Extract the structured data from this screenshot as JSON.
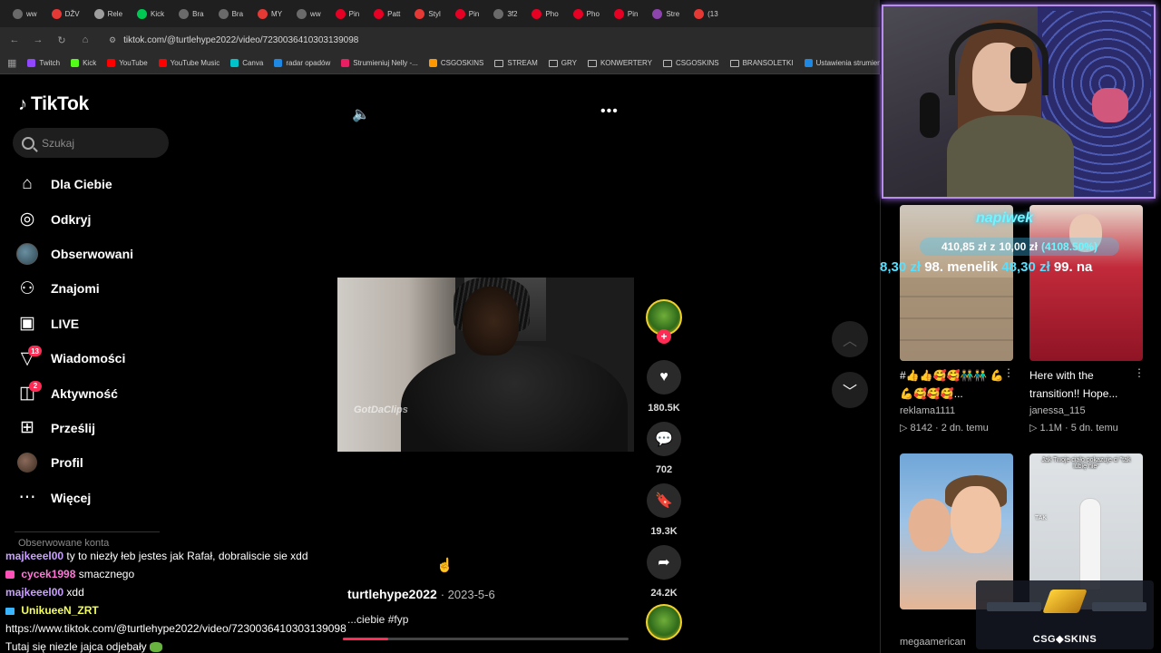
{
  "browser": {
    "tabs": [
      "ww",
      "DŽV",
      "Rele",
      "Kick",
      "Bra",
      "Bra",
      "MY",
      "ww",
      "Pin",
      "Patt",
      "Styl",
      "Pin",
      "3f2",
      "Pho",
      "Pho",
      "Pin",
      "Stre",
      "(13"
    ],
    "url": "tiktok.com/@turtlehype2022/video/7230036410303139098",
    "bookmarks": [
      "Twitch",
      "Kick",
      "YouTube",
      "YouTube Music",
      "Canva",
      "radar opadów",
      "Strumieniuj Nelly -...",
      "CSGOSKINS",
      "STREAM",
      "GRY",
      "KONWERTERY",
      "CSGOSKINS",
      "BRANSOLETKI",
      "Ustawienia strumien..."
    ]
  },
  "tiktok": {
    "logo": "TikTok",
    "search_placeholder": "Szukaj",
    "nav": [
      {
        "label": "Dla Ciebie",
        "icon": "home-icon"
      },
      {
        "label": "Odkryj",
        "icon": "compass-icon"
      },
      {
        "label": "Obserwowani",
        "icon": "following-avatar-icon"
      },
      {
        "label": "Znajomi",
        "icon": "friends-icon"
      },
      {
        "label": "LIVE",
        "icon": "live-icon"
      },
      {
        "label": "Wiadomości",
        "icon": "messages-icon",
        "badge": "13"
      },
      {
        "label": "Aktywność",
        "icon": "activity-icon",
        "badge": "2"
      },
      {
        "label": "Prześlij",
        "icon": "upload-icon"
      },
      {
        "label": "Profil",
        "icon": "profile-avatar-icon"
      },
      {
        "label": "Więcej",
        "icon": "more-icon"
      }
    ],
    "followed_title": "Obserwowane konta"
  },
  "video": {
    "watermark": "GotDaClips",
    "author": "turtlehype2022",
    "date": "· 2023-5-6",
    "caption": "...ciebie #fyp",
    "likes": "180.5K",
    "comments": "702",
    "saves": "19.3K",
    "shares": "24.2K",
    "progress": 0.16
  },
  "recommendations": [
    {
      "title": "#👍👍🥰🥰👬👬 💪💪🥰🥰🥰...",
      "author": "reklama1111",
      "meta": "▷ 8142 · 2 dn. temu"
    },
    {
      "title": "Here with the transition!! Hope...",
      "author": "janessa_115",
      "meta": "▷ 1.1M · 5 dn. temu"
    },
    {
      "title": "",
      "author": "",
      "meta": ""
    },
    {
      "title": "",
      "author": "",
      "meta": "",
      "overlay": "Jak Twoje ciało pokazuje ci \"tak lubię nie\"",
      "overlay2": "TAK"
    }
  ],
  "bottom_author": "megaamerican",
  "stream": {
    "tip_title": "napiwek",
    "tip_amount": "410,85 zł",
    "tip_of": "z",
    "tip_goal": "10,00 zł",
    "tip_pct": "(4108.50%)",
    "ticker": [
      {
        "amt": "8,30 zł",
        "nm": "98. menelik"
      },
      {
        "amt": "48,30 zł",
        "nm": "99. na"
      }
    ],
    "chat": [
      {
        "user": "majkeeel00",
        "text": "ty to niezły łeb jestes jak Rafał, dobraliscie sie xdd"
      },
      {
        "user": "cycek1998",
        "text": "smacznego"
      },
      {
        "user": "majkeeel00",
        "text": "xdd"
      },
      {
        "user": "UnikueeN_ZRT",
        "text": ""
      },
      {
        "user": "",
        "text": "https://www.tiktok.com/@turtlehype2022/video/7230036410303139098"
      },
      {
        "user": "",
        "text": "Tutaj się niezle jajca odjebały"
      }
    ],
    "sponsor": "CSG◆SKINS"
  }
}
